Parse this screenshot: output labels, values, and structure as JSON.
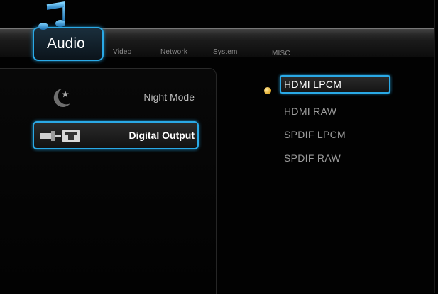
{
  "tabs": {
    "active": "Audio",
    "items": [
      "Video",
      "Network",
      "System",
      "MISC"
    ]
  },
  "left_menu": {
    "items": [
      {
        "label": "Night Mode",
        "icon": "moon-star-icon"
      },
      {
        "label": "Digital Output",
        "icon": "digital-output-icon"
      }
    ],
    "selected_index": 1
  },
  "options": {
    "items": [
      "HDMI LPCM",
      "HDMI RAW",
      "SPDIF LPCM",
      "SPDIF RAW"
    ],
    "selected_index": 0
  },
  "colors": {
    "accent": "#2aa9e6",
    "selected_dot": "#e0a928",
    "background": "#020202"
  }
}
